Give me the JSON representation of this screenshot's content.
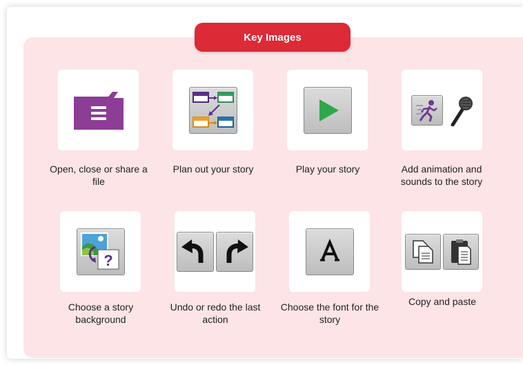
{
  "header": {
    "title": "Key Images"
  },
  "items": [
    {
      "label": "Open, close or share a file",
      "icon": "folder-menu-icon"
    },
    {
      "label": "Plan out your story",
      "icon": "storyboard-plan-icon"
    },
    {
      "label": "Play your story",
      "icon": "play-icon"
    },
    {
      "label": "Add animation and sounds to the story",
      "icon": "animation-and-microphone-icon"
    },
    {
      "label": "Choose a story background",
      "icon": "background-picture-icon"
    },
    {
      "label": "Undo or redo the last action",
      "icon": "undo-redo-icon"
    },
    {
      "label": "Choose the font for the story",
      "icon": "font-icon"
    },
    {
      "label": "Copy and paste",
      "icon": "copy-paste-icon"
    }
  ],
  "colors": {
    "accent": "#dc2a36",
    "panel_background": "#fde4e6",
    "folder_purple": "#8c3d96",
    "play_green": "#2ea84a"
  }
}
